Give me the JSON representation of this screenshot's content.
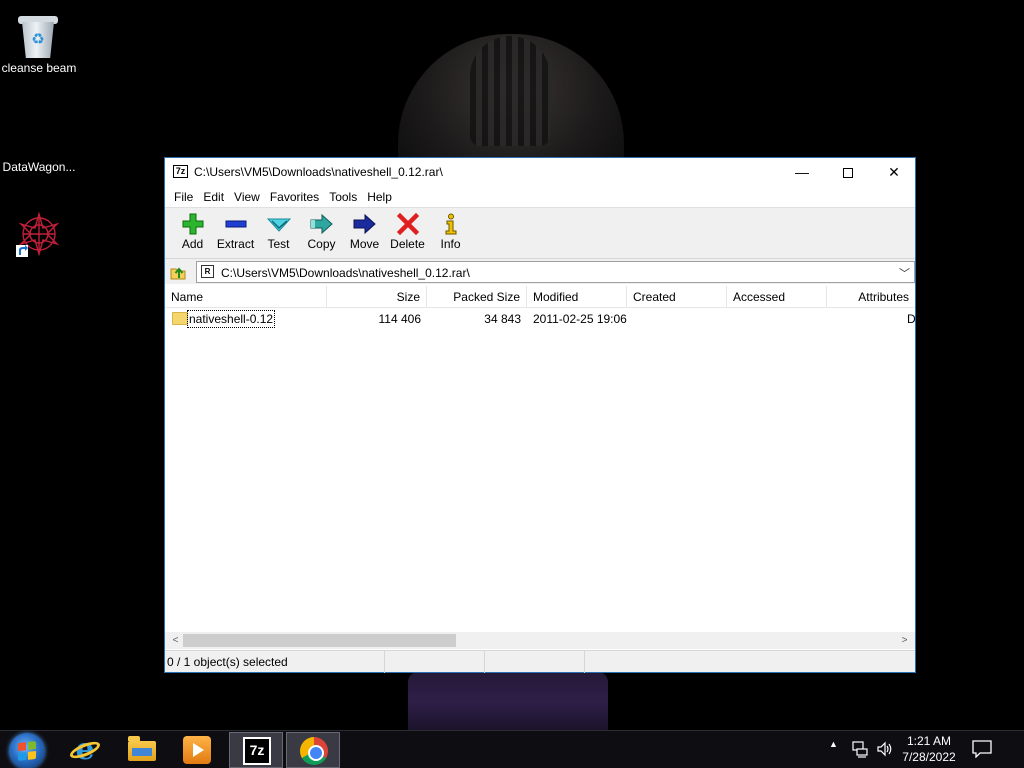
{
  "desktop": {
    "icons": [
      {
        "label": "cleanse beam",
        "icon": "recycle-bin-icon"
      },
      {
        "label": "DataWagon...",
        "icon": "shortcut-icon"
      }
    ]
  },
  "window": {
    "title": "C:\\Users\\VM5\\Downloads\\nativeshell_0.12.rar\\",
    "controls": {
      "minimize": "—",
      "close": "✕"
    },
    "menu": [
      "File",
      "Edit",
      "View",
      "Favorites",
      "Tools",
      "Help"
    ],
    "toolbar": [
      {
        "label": "Add",
        "icon": "add-icon"
      },
      {
        "label": "Extract",
        "icon": "extract-icon"
      },
      {
        "label": "Test",
        "icon": "test-icon"
      },
      {
        "label": "Copy",
        "icon": "copy-icon"
      },
      {
        "label": "Move",
        "icon": "move-icon"
      },
      {
        "label": "Delete",
        "icon": "delete-icon"
      },
      {
        "label": "Info",
        "icon": "info-icon"
      }
    ],
    "address": {
      "path": "C:\\Users\\VM5\\Downloads\\nativeshell_0.12.rar\\",
      "dropdown": "﹀"
    },
    "columns": [
      "Name",
      "Size",
      "Packed Size",
      "Modified",
      "Created",
      "Accessed",
      "Attributes"
    ],
    "rows": [
      {
        "name": "nativeshell-0.12",
        "size": "114 406",
        "packed_size": "34 843",
        "modified": "2011-02-25 19:06",
        "created": "",
        "accessed": "",
        "attributes": "D"
      }
    ],
    "scroll": {
      "left": "<",
      "right": ">"
    },
    "status": "0 / 1 object(s) selected"
  },
  "taskbar": {
    "apps": [
      {
        "name": "Internet Explorer",
        "icon": "internet-explorer-icon"
      },
      {
        "name": "File Explorer",
        "icon": "file-explorer-icon"
      },
      {
        "name": "Windows Media Player",
        "icon": "media-player-icon"
      },
      {
        "name": "7-Zip",
        "icon": "7zip-icon",
        "active": true,
        "label": "7z"
      },
      {
        "name": "Google Chrome",
        "icon": "chrome-icon"
      }
    ],
    "tray": {
      "arrow": "▲",
      "time": "1:21 AM",
      "date": "7/28/2022"
    }
  },
  "colors": {
    "window_border": "#2b6fb3",
    "toolbar_bg": "#f0f0f0",
    "folder": "#f5d66e"
  }
}
